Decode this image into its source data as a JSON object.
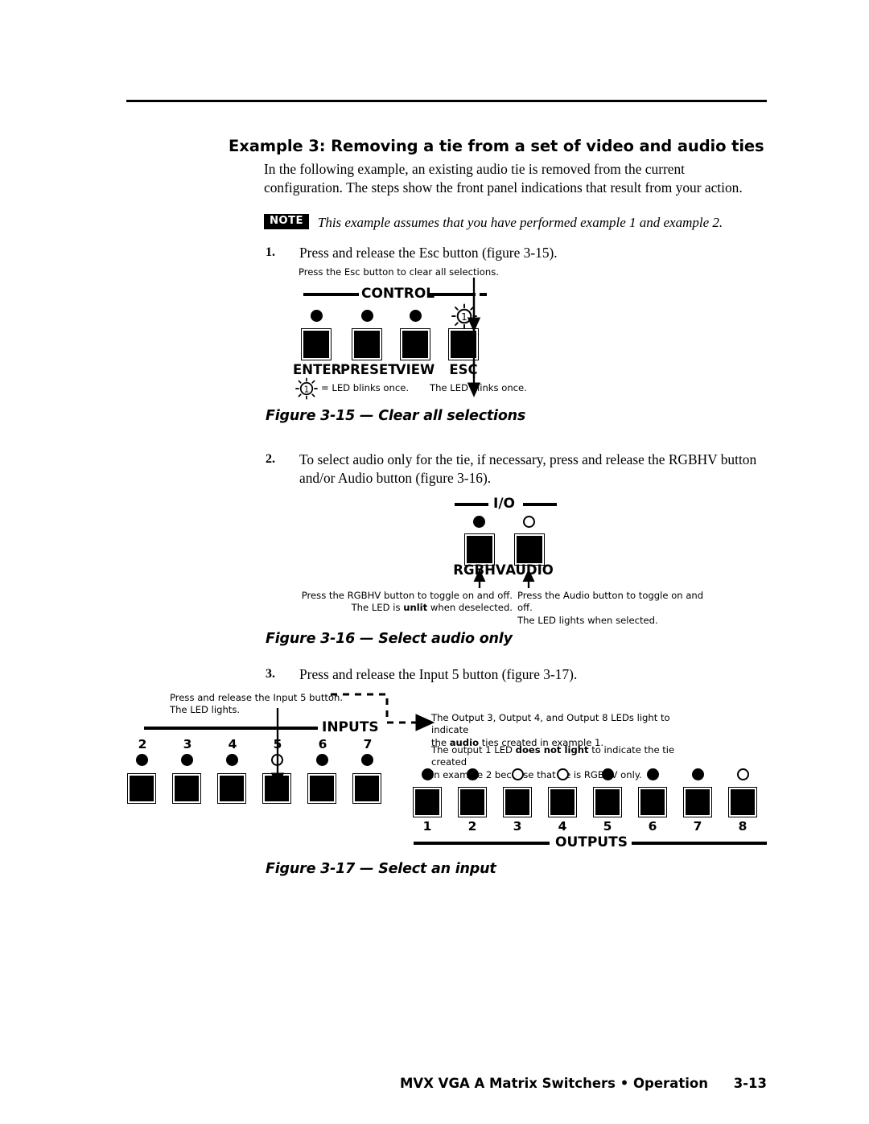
{
  "document": {
    "section_title": "Example 3: Removing a tie from a set of video and audio ties",
    "intro_paragraph": "In the following example, an existing audio tie is removed from the current configuration.  The steps show the front panel indications that result from your action.",
    "note": {
      "badge": "NOTE",
      "text": "This example assumes that you have performed example 1 and example 2."
    }
  },
  "steps": [
    {
      "number": "1.",
      "text": "Press and release the Esc button (figure 3-15)."
    },
    {
      "number": "2.",
      "text": "To select audio only for the tie, if necessary, press and release the RGBHV button and/or Audio button (figure 3-16)."
    },
    {
      "number": "3.",
      "text": "Press and release the Input 5 button (figure 3-17)."
    }
  ],
  "figure_315": {
    "caption": "Figure 3-15 — Clear all selections",
    "panel_label": "CONTROL",
    "callout_top": "Press the Esc button to clear all selections.",
    "legend_text": "= LED blinks once.",
    "callout_bottom": "The LED blinks once.",
    "blink_glyph_number": "1",
    "buttons": [
      {
        "label": "ENTER",
        "led": "on"
      },
      {
        "label": "PRESET",
        "led": "on"
      },
      {
        "label": "VIEW",
        "led": "on"
      },
      {
        "label": "ESC",
        "led": "blink"
      }
    ]
  },
  "figure_316": {
    "caption": "Figure 3-16 — Select audio only",
    "panel_label": "I/O",
    "buttons": [
      {
        "label": "RGBHV",
        "led": "on"
      },
      {
        "label": "AUDIO",
        "led": "off"
      }
    ],
    "callout_left_line1": "Press the RGBHV button to toggle on and off.",
    "callout_left_line2_a": "The LED is ",
    "callout_left_line2_b": "unlit",
    "callout_left_line2_c": " when deselected.",
    "callout_right_line1": "Press the Audio button to toggle on and off.",
    "callout_right_line2": "The LED lights when selected."
  },
  "figure_317": {
    "caption": "Figure 3-17 — Select an input",
    "inputs_label": "INPUTS",
    "outputs_label": "OUTPUTS",
    "callout_input_line1": "Press and release the Input 5 button.",
    "callout_input_line2": "The LED lights.",
    "callout_output_1a": "The Output 3, Output 4, and Output 8 LEDs light to indicate",
    "callout_output_1b": "the ",
    "callout_output_1c": "audio",
    "callout_output_1d": " ties created in example 1.",
    "callout_output_2a": "The output 1 LED ",
    "callout_output_2b": "does not light",
    "callout_output_2c": " to indicate the tie created",
    "callout_output_2d": "in example 2 because that tie is RGBHV only.",
    "inputs": [
      {
        "number": "2",
        "led": "on"
      },
      {
        "number": "3",
        "led": "on"
      },
      {
        "number": "4",
        "led": "on"
      },
      {
        "number": "5",
        "led": "off"
      },
      {
        "number": "6",
        "led": "on"
      },
      {
        "number": "7",
        "led": "on"
      }
    ],
    "outputs": [
      {
        "number": "1",
        "led": "on"
      },
      {
        "number": "2",
        "led": "on"
      },
      {
        "number": "3",
        "led": "off"
      },
      {
        "number": "4",
        "led": "off"
      },
      {
        "number": "5",
        "led": "on"
      },
      {
        "number": "6",
        "led": "on"
      },
      {
        "number": "7",
        "led": "on"
      },
      {
        "number": "8",
        "led": "off"
      }
    ]
  },
  "footer": {
    "title": "MVX VGA A Matrix Switchers • Operation",
    "page_number": "3-13"
  }
}
